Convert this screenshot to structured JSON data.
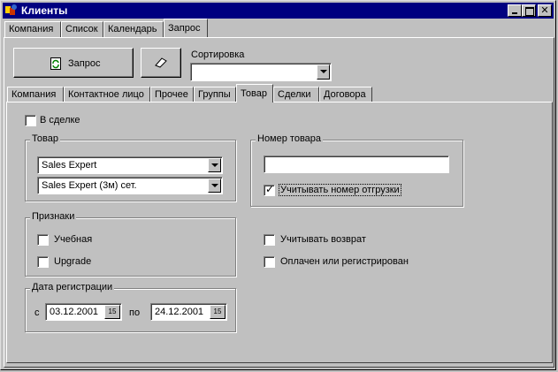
{
  "window": {
    "title": "Клиенты"
  },
  "main_tabs": [
    {
      "label": "Компания"
    },
    {
      "label": "Список"
    },
    {
      "label": "Календарь"
    },
    {
      "label": "Запрос"
    }
  ],
  "toolbar": {
    "query_button": "Запрос"
  },
  "sort": {
    "label": "Сортировка",
    "value": ""
  },
  "sub_tabs": [
    {
      "label": "Компания"
    },
    {
      "label": "Контактное лицо"
    },
    {
      "label": "Прочее"
    },
    {
      "label": "Группы"
    },
    {
      "label": "Товар"
    },
    {
      "label": "Сделки"
    },
    {
      "label": "Договора"
    }
  ],
  "in_deal": {
    "label": "В сделке",
    "checked": false
  },
  "product_group": {
    "label": "Товар",
    "product": "Sales Expert",
    "variant": "Sales Expert (3м) сет."
  },
  "product_number": {
    "label": "Номер товара",
    "value": "",
    "consider_shipment_label": "Учитывать номер отгрузки",
    "consider_shipment_checked": true
  },
  "signs": {
    "label": "Признаки",
    "training": "Учебная",
    "upgrade": "Upgrade"
  },
  "options": {
    "consider_return": "Учитывать возврат",
    "paid_or_registered": "Оплачен или регистрирован"
  },
  "registration_date": {
    "label": "Дата регистрации",
    "from_label": "с",
    "from_value": "03.12.2001",
    "to_label": "по",
    "to_value": "24.12.2001",
    "calendar_icon_text": "15"
  },
  "colors": {
    "titlebar": "#000080",
    "face": "#c0c0c0",
    "check": "#000000"
  }
}
